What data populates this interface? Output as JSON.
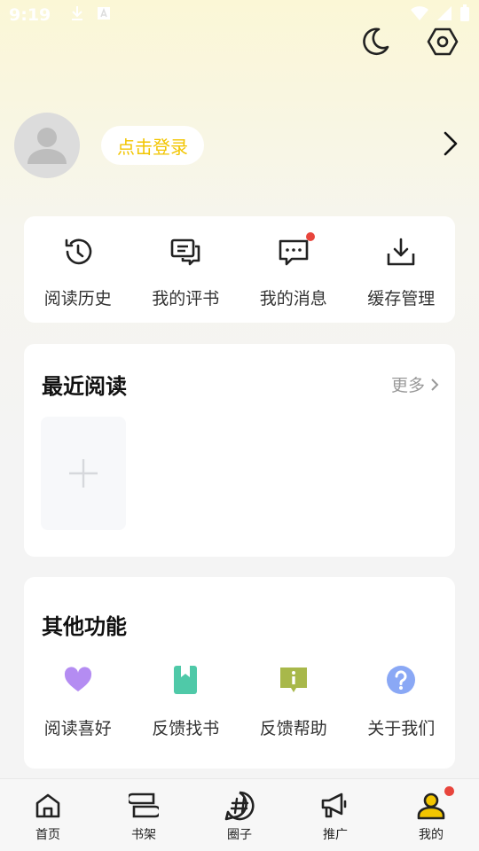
{
  "status_bar": {
    "time": "9:19"
  },
  "profile": {
    "login_label": "点击登录"
  },
  "quick_actions": [
    {
      "label": "阅读历史",
      "icon": "history-icon"
    },
    {
      "label": "我的评书",
      "icon": "comment-icon"
    },
    {
      "label": "我的消息",
      "icon": "message-icon",
      "badge": true
    },
    {
      "label": "缓存管理",
      "icon": "download-icon"
    }
  ],
  "recent": {
    "title": "最近阅读",
    "more_label": "更多"
  },
  "other": {
    "title": "其他功能",
    "items": [
      {
        "label": "阅读喜好",
        "icon": "heart-icon",
        "color": "#b48cf2"
      },
      {
        "label": "反馈找书",
        "icon": "bookmark-book-icon",
        "color": "#4fc9a8"
      },
      {
        "label": "反馈帮助",
        "icon": "info-chat-icon",
        "color": "#a8b84a"
      },
      {
        "label": "关于我们",
        "icon": "question-icon",
        "color": "#8aa8f5"
      }
    ]
  },
  "nav": [
    {
      "label": "首页",
      "icon": "home-icon"
    },
    {
      "label": "书架",
      "icon": "bookshelf-icon"
    },
    {
      "label": "圈子",
      "icon": "hashtag-icon"
    },
    {
      "label": "推广",
      "icon": "megaphone-icon"
    },
    {
      "label": "我的",
      "icon": "user-icon",
      "active": true,
      "badge": true
    }
  ],
  "colors": {
    "accent": "#f2c500",
    "badge": "#e8453c"
  }
}
